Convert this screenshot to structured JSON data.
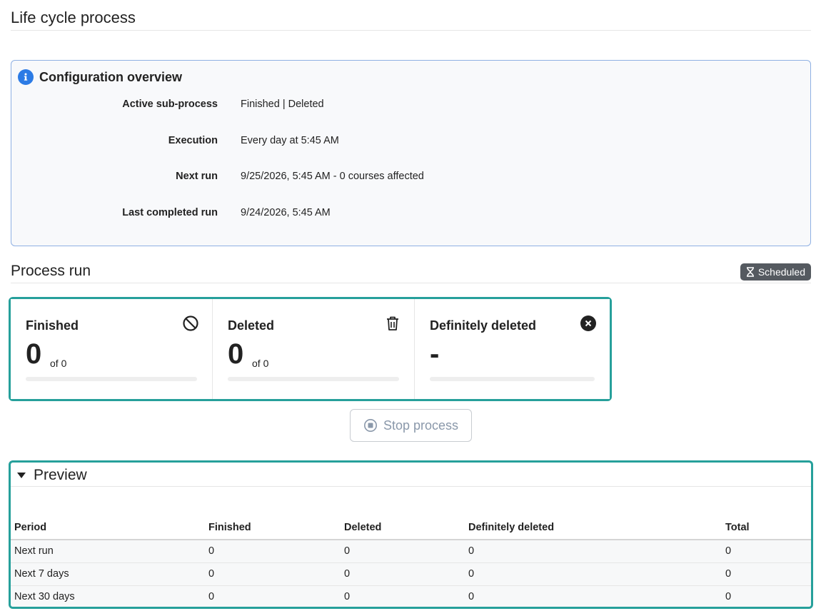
{
  "page": {
    "title": "Life cycle process"
  },
  "config": {
    "title": "Configuration overview",
    "rows": [
      {
        "label": "Active sub-process",
        "value": "Finished | Deleted"
      },
      {
        "label": "Execution",
        "value": "Every day at 5:45 AM"
      },
      {
        "label": "Next run",
        "value": "9/25/2026, 5:45 AM - 0 courses affected"
      },
      {
        "label": "Last completed run",
        "value": "9/24/2026, 5:45 AM"
      }
    ]
  },
  "process_run": {
    "title": "Process run",
    "status_badge": "Scheduled",
    "cards": [
      {
        "title": "Finished",
        "count": "0",
        "of": "of 0",
        "icon": "ban-icon",
        "progress": 0
      },
      {
        "title": "Deleted",
        "count": "0",
        "of": "of 0",
        "icon": "trash-icon",
        "progress": 0
      },
      {
        "title": "Definitely deleted",
        "count": "-",
        "of": "",
        "icon": "close-circle-icon",
        "progress": 0
      }
    ],
    "stop_button": "Stop process"
  },
  "preview": {
    "title": "Preview",
    "columns": [
      "Period",
      "Finished",
      "Deleted",
      "Definitely deleted",
      "Total"
    ],
    "rows": [
      [
        "Next run",
        "0",
        "0",
        "0",
        "0"
      ],
      [
        "Next 7 days",
        "0",
        "0",
        "0",
        "0"
      ],
      [
        "Next 30 days",
        "0",
        "0",
        "0",
        "0"
      ]
    ]
  },
  "colors": {
    "accent": "#26a09b",
    "info": "#2c7be5",
    "badge": "#555a60"
  }
}
